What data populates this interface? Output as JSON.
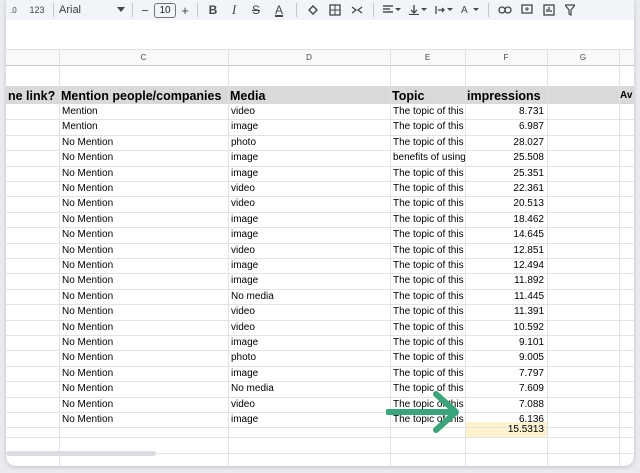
{
  "toolbar": {
    "format_label": "123",
    "font_name": "Arial",
    "font_size": "10",
    "minus": "−",
    "plus": "+",
    "bold": "B",
    "italic": "I",
    "strike": "S",
    "textcolor": "A"
  },
  "columns": {
    "C": "C",
    "D": "D",
    "E": "E",
    "F": "F",
    "G": "G"
  },
  "headers": {
    "b": "ne link?",
    "c": "Mention people/companies",
    "d": "Media",
    "e": "Topic",
    "f": "impressions",
    "h": "Av"
  },
  "rows": [
    {
      "c": "Mention",
      "d": "video",
      "e": "The topic of this",
      "f": "8.731"
    },
    {
      "c": "Mention",
      "d": "image",
      "e": "The topic of this",
      "f": "6.987"
    },
    {
      "c": "No Mention",
      "d": "photo",
      "e": "The topic of this",
      "f": "28.027"
    },
    {
      "c": "No Mention",
      "d": "image",
      "e": "benefits of using",
      "f": "25.508"
    },
    {
      "c": "No Mention",
      "d": "image",
      "e": "The topic of this",
      "f": "25.351"
    },
    {
      "c": "No Mention",
      "d": "video",
      "e": "The topic of this",
      "f": "22.361"
    },
    {
      "c": "No Mention",
      "d": "video",
      "e": "The topic of this",
      "f": "20.513"
    },
    {
      "c": "No Mention",
      "d": "image",
      "e": "The topic of this",
      "f": "18.462"
    },
    {
      "c": "No Mention",
      "d": "image",
      "e": "The topic of this",
      "f": "14.645"
    },
    {
      "c": "No Mention",
      "d": "video",
      "e": "The topic of this",
      "f": "12.851"
    },
    {
      "c": "No Mention",
      "d": "image",
      "e": "The topic of this",
      "f": "12.494"
    },
    {
      "c": "No Mention",
      "d": "image",
      "e": "The topic of this",
      "f": "11.892"
    },
    {
      "c": "No Mention",
      "d": "No media",
      "e": "The topic of this",
      "f": "11.445"
    },
    {
      "c": "No Mention",
      "d": "video",
      "e": "The topic of this",
      "f": "11.391"
    },
    {
      "c": "No Mention",
      "d": "video",
      "e": "The topic of this",
      "f": "10.592"
    },
    {
      "c": "No Mention",
      "d": "image",
      "e": "The topic of this",
      "f": "9.101"
    },
    {
      "c": "No Mention",
      "d": "photo",
      "e": "The topic of this",
      "f": "9.005"
    },
    {
      "c": "No Mention",
      "d": "image",
      "e": "The topic of this",
      "f": "7.797"
    },
    {
      "c": "No Mention",
      "d": "No media",
      "e": "The topic of this",
      "f": "7.609"
    },
    {
      "c": "No Mention",
      "d": "video",
      "e": "The topic of this",
      "f": "7.088"
    },
    {
      "c": "No Mention",
      "d": "image",
      "e": "The topic of this",
      "f": "6.136"
    }
  ],
  "average": "15.5313",
  "colors": {
    "highlight": "#fff2cc",
    "arrow": "#3aa57a",
    "header_band": "#d9d9d9"
  },
  "icons": [
    "undo-icon",
    "redo-icon",
    "link-icon",
    "comment-icon",
    "chart-icon",
    "filter-icon",
    "borders-icon",
    "fill-color-icon"
  ]
}
